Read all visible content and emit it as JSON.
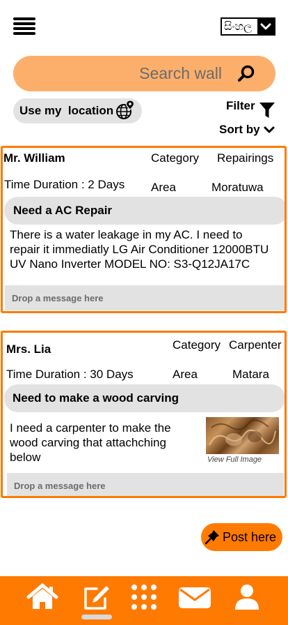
{
  "header": {
    "language_label": "සිංහල"
  },
  "search": {
    "placeholder": "Search wall"
  },
  "controls": {
    "location_label": "Use my  location",
    "filter_label": "Filter",
    "sort_label": "Sort by"
  },
  "posts": [
    {
      "name": "Mr. William",
      "category_label": "Category",
      "category_value": "Repairings",
      "duration": "Time Duration : 2 Days",
      "area_label": "Area",
      "area_value": "Moratuwa",
      "title": "Need a AC Repair",
      "description": "There is a water leakage in my AC. I need to repair it immediatly LG Air Conditioner 12000BTU UV Nano Inverter MODEL NO: S3-Q12JA17C",
      "message_placeholder": "Drop a message here"
    },
    {
      "name": "Mrs. Lia",
      "category_label": "Category",
      "category_value": "Carpenter",
      "duration": "Time Duration : 30 Days",
      "area_label": "Area",
      "area_value": "Matara",
      "title": "Need to make a wood carving",
      "description": "I need a carpenter to make the wood carving that attachching below",
      "image_caption": "View Full Image",
      "message_placeholder": "Drop a message here"
    }
  ],
  "post_button": {
    "label": "Post here"
  },
  "bottom_nav": {
    "items": [
      "home-icon",
      "edit-icon",
      "apps-grid-icon",
      "mail-icon",
      "profile-icon"
    ],
    "active": "edit-icon"
  },
  "colors": {
    "accent": "#FF7A00",
    "search_bg": "#FCAF6B",
    "chip_bg": "#E2E2E2"
  }
}
